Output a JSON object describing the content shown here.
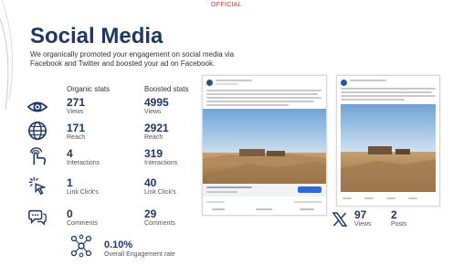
{
  "classification": "OFFICIAL",
  "title": "Social Media",
  "subtitle": "We organically promoted your engagement on social media via Facebook and Twitter and boosted your ad on Facebook.",
  "columns": {
    "organic": "Organic stats",
    "boosted": "Boosted stats"
  },
  "stats": [
    {
      "icon": "eye-icon",
      "organic_value": "271",
      "boosted_value": "4995",
      "organic_label": "Views",
      "boosted_label": "Views"
    },
    {
      "icon": "globe-icon",
      "organic_value": "171",
      "boosted_value": "2921",
      "organic_label": "Reach",
      "boosted_label": "Reach"
    },
    {
      "icon": "hand-interaction-icon",
      "organic_value": "4",
      "boosted_value": "319",
      "organic_label": "Interactions",
      "boosted_label": "Interactions"
    },
    {
      "icon": "cursor-click-icon",
      "organic_value": "1",
      "boosted_value": "40",
      "organic_label": "Link Click's",
      "boosted_label": "Link Click's"
    },
    {
      "icon": "comment-icon",
      "organic_value": "0",
      "boosted_value": "29",
      "organic_label": "Comments",
      "boosted_label": "Comments"
    }
  ],
  "engagement": {
    "icon": "network-icon",
    "value": "0.10%",
    "label": "Overall Engagement rate"
  },
  "twitter": {
    "icon": "x-logo-icon",
    "views_value": "97",
    "views_label": "Views",
    "posts_value": "2",
    "posts_label": "Posts"
  },
  "colors": {
    "heading": "#1f3763",
    "classification": "#d0342c",
    "accent": "#2f6bd8"
  }
}
